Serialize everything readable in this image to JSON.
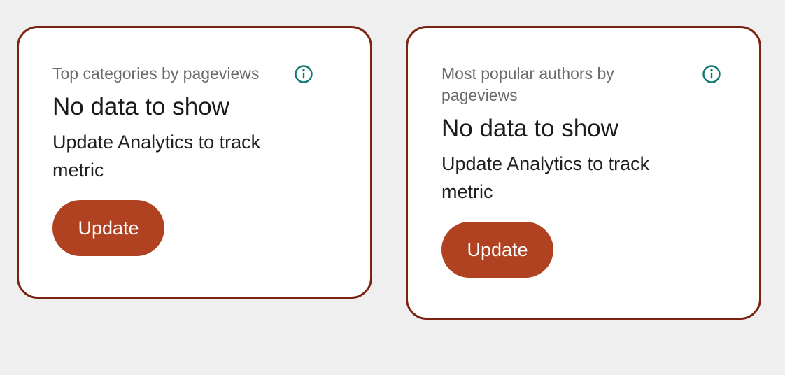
{
  "cards": [
    {
      "title": "Top categories by pageviews",
      "empty_heading": "No data to show",
      "empty_message": "Update Analytics to track metric",
      "button_label": "Update",
      "info_icon": "info-icon"
    },
    {
      "title": "Most popular authors by pageviews",
      "empty_heading": "No data to show",
      "empty_message": "Update Analytics to track metric",
      "button_label": "Update",
      "info_icon": "info-icon"
    }
  ],
  "colors": {
    "background": "#efefef",
    "card_border": "#7a2410",
    "button_bg": "#b04221",
    "button_text": "#ffffff",
    "info_icon": "#127a72",
    "title_text": "#6b6b6b",
    "heading_text": "#1a1a1a"
  }
}
